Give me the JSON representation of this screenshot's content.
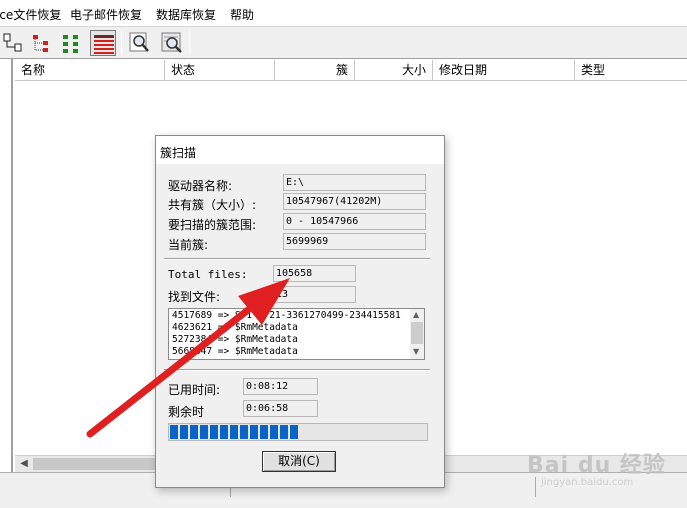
{
  "menubar": {
    "items": [
      "ice文件恢复",
      "电子邮件恢复",
      "数据库恢复",
      "帮助"
    ]
  },
  "toolbar": {
    "tools": [
      "tree-doc-icon",
      "tree-red-icon",
      "tree-green-icon",
      "list-red-icon",
      "magnifier-icon",
      "scan-magnifier-icon"
    ]
  },
  "file_list": {
    "columns": [
      "名称",
      "状态",
      "簇",
      "大小",
      "修改日期",
      "类型"
    ]
  },
  "dialog": {
    "title": "簇扫描",
    "drive_label": "驱动器名称:",
    "drive_value": "E:\\",
    "total_clusters_label": "共有簇（大小）:",
    "total_clusters_value": "10547967(41202M)",
    "scan_range_label": "要扫描的簇范围:",
    "scan_range_value": "0 - 10547966",
    "current_cluster_label": "当前簇:",
    "current_cluster_value": "5699969",
    "total_files_label": "Total files:",
    "total_files_value": "105658",
    "found_files_label": "找到文件:",
    "found_files_value": "13",
    "found_list": [
      "4517689 => S-1-5-21-3361270499-234415581",
      "4623621 => $RmMetadata",
      "5272384 => $RmMetadata",
      "5668847 => $RmMetadata"
    ],
    "elapsed_label": "已用时间:",
    "elapsed_value": "0:08:12",
    "remaining_label": "剩余时",
    "remaining_value": "0:06:58",
    "progress_fraction": 0.54,
    "cancel_label": "取消(C)"
  },
  "watermark": {
    "main": "Bai du 经验",
    "sub": "jingyan.baidu.com"
  },
  "colors": {
    "progress": "#0a64c8",
    "arrow": "#e02020"
  }
}
